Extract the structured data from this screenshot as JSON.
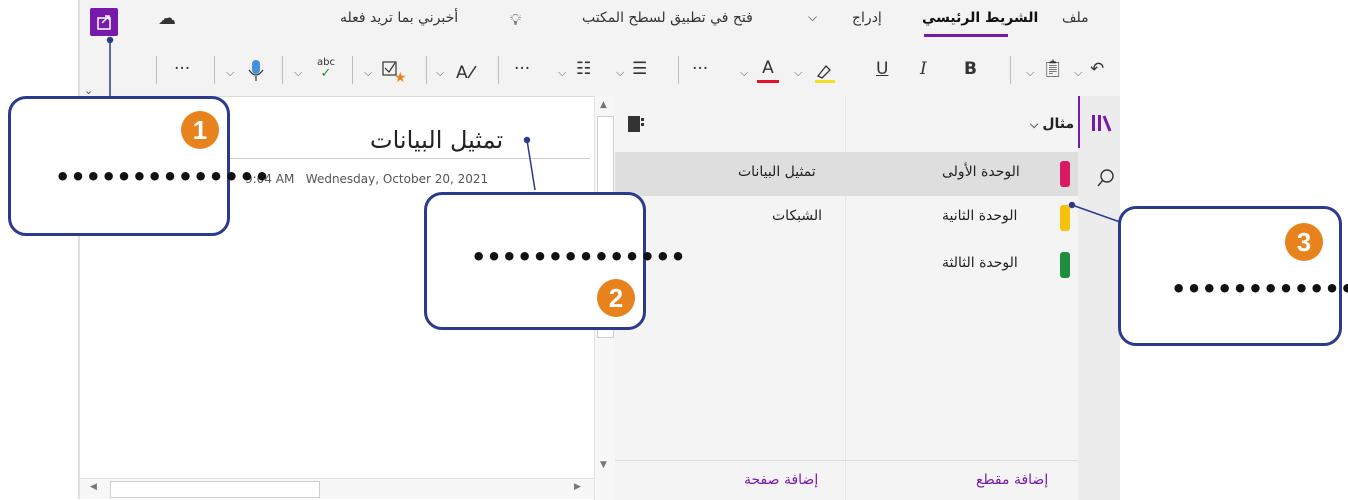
{
  "ribbon": {
    "menus": [
      "ملف",
      "الشريط الرئيسي",
      "إدراج",
      "فتح في تطبيق لسطح المكتب"
    ],
    "tell_me": "أخبرني بما تريد فعله",
    "tools": {
      "paste": "📋",
      "bold": "B",
      "italic": "I",
      "underline": "U",
      "font_color": "A",
      "more": "···",
      "spelling": "abc",
      "dictate": "🎤"
    }
  },
  "notebook": {
    "name": "مثال"
  },
  "sections": [
    {
      "label": "الوحدة الأولى",
      "color": "#d81b60",
      "page": "تمثيل البيانات"
    },
    {
      "label": "الوحدة الثانية",
      "color": "#f4c20d",
      "page": "الشبكات"
    },
    {
      "label": "الوحدة الثالثة",
      "color": "#1e8e3e",
      "page": ""
    }
  ],
  "footer": {
    "add_section": "إضافة مقطع",
    "add_page": "إضافة صفحة"
  },
  "page": {
    "title": "تمثيل البيانات",
    "date": "Wednesday, October 20, 2021",
    "time": "9:04 AM"
  },
  "callouts": [
    {
      "number": "1",
      "text": "••••••••••••••"
    },
    {
      "number": "2",
      "text": "••••••••••••••"
    },
    {
      "number": "3",
      "text": "••••••••••••••"
    }
  ],
  "colors": {
    "accent": "#7719aa",
    "callout_border": "#2b3a8c",
    "badge": "#e8821c"
  }
}
